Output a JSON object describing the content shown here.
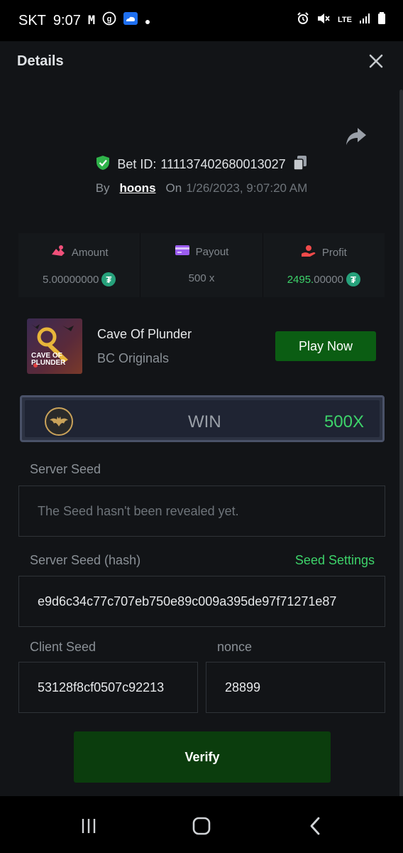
{
  "status_bar": {
    "carrier": "SKT",
    "time": "9:07",
    "mail_letter": "M",
    "network": "LTE"
  },
  "header": {
    "title": "Details"
  },
  "bet": {
    "id_label": "Bet ID:",
    "id": "111137402680013027",
    "by_label": "By",
    "user": "hoons",
    "on_label": "On",
    "datetime": "1/26/2023, 9:07:20 AM"
  },
  "stats": {
    "amount_label": "Amount",
    "amount_int": "5.",
    "amount_dec": "00000000",
    "payout_label": "Payout",
    "payout_value": "500 x",
    "profit_label": "Profit",
    "profit_int": "2495.",
    "profit_dec": "00000",
    "currency_symbol": "₮"
  },
  "game": {
    "name": "Cave Of Plunder",
    "provider": "BC Originals",
    "thumb_text_1": "CAVE OF",
    "thumb_text_2": "PLUNDER",
    "play_label": "Play Now"
  },
  "result": {
    "label": "WIN",
    "multiplier": "500X"
  },
  "server_seed": {
    "label": "Server Seed",
    "placeholder": "The Seed hasn't been revealed yet."
  },
  "server_seed_hash": {
    "label": "Server Seed (hash)",
    "settings_link": "Seed Settings",
    "value": "e9d6c34c77c707eb750e89c009a395de97f71271e87"
  },
  "client_seed": {
    "label": "Client Seed",
    "value": "53128f8cf0507c92213"
  },
  "nonce": {
    "label": "nonce",
    "value": "28899"
  },
  "verify_label": "Verify",
  "colors": {
    "accent_green": "#3dd36a",
    "button_green": "#0b5d13",
    "verify_green": "#0b3d0d",
    "panel_bg": "#121417"
  }
}
